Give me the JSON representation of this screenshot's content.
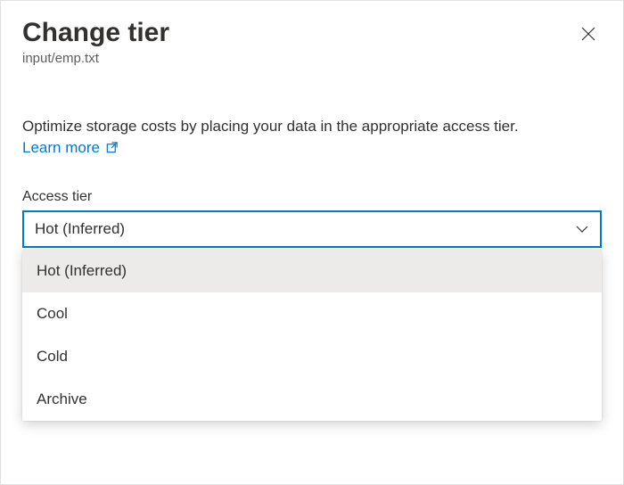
{
  "header": {
    "title": "Change tier",
    "subtitle": "input/emp.txt"
  },
  "description": {
    "text": "Optimize storage costs by placing your data in the appropriate access tier.",
    "learn_more": "Learn more"
  },
  "field": {
    "label": "Access tier",
    "selected": "Hot (Inferred)",
    "options": [
      "Hot (Inferred)",
      "Cool",
      "Cold",
      "Archive"
    ]
  }
}
